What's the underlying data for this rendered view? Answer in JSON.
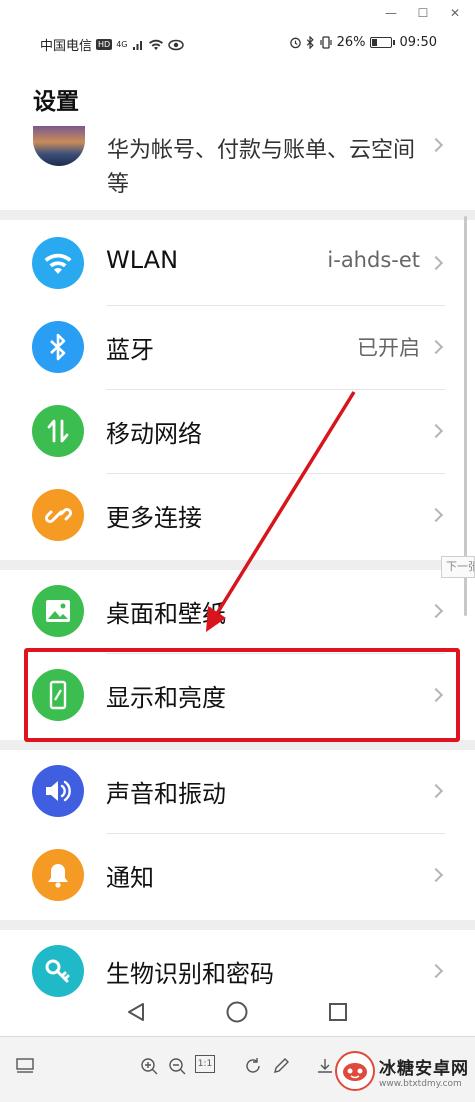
{
  "status_bar": {
    "carrier": "中国电信",
    "hd": "HD",
    "signal_gen": "4G",
    "battery_percent": "26%",
    "battery_level": 0.26,
    "time": "09:50"
  },
  "page_title": "设置",
  "account": {
    "text": "华为帐号、付款与账单、云空间等"
  },
  "items": [
    {
      "label": "WLAN",
      "value": "i-ahds-et",
      "icon": "wifi-icon",
      "color": "#29a9ef"
    },
    {
      "label": "蓝牙",
      "value": "已开启",
      "icon": "bluetooth-icon",
      "color": "#2a9df4"
    },
    {
      "label": "移动网络",
      "value": "",
      "icon": "mobile-data-icon",
      "color": "#3bbd4f"
    },
    {
      "label": "更多连接",
      "value": "",
      "icon": "link-icon",
      "color": "#f59a23"
    },
    {
      "label": "桌面和壁纸",
      "value": "",
      "icon": "image-icon",
      "color": "#3bbd4f"
    },
    {
      "label": "显示和亮度",
      "value": "",
      "icon": "display-icon",
      "color": "#3bbd4f"
    },
    {
      "label": "声音和振动",
      "value": "",
      "icon": "sound-icon",
      "color": "#3f5fe0"
    },
    {
      "label": "通知",
      "value": "",
      "icon": "bell-icon",
      "color": "#f59a23"
    },
    {
      "label": "生物识别和密码",
      "value": "",
      "icon": "key-icon",
      "color": "#1fb9c8"
    }
  ],
  "side_tab": "下一张",
  "toolbar": {
    "zoom_reset": "1:1"
  },
  "watermark": {
    "title": "冰糖安卓网",
    "url": "www.btxtdmy.com"
  },
  "colors": {
    "highlight": "#e0141e",
    "arrow": "#d8141c"
  }
}
